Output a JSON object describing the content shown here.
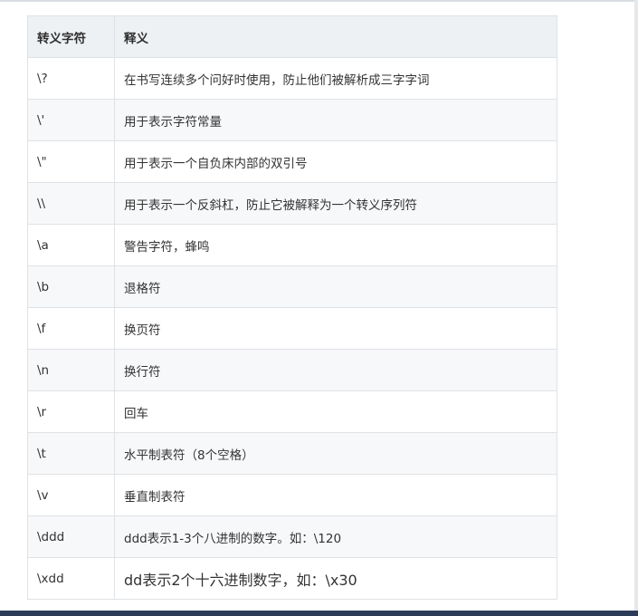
{
  "table": {
    "headers": [
      "转义字符",
      "释义"
    ],
    "rows": [
      {
        "code": "\\?",
        "desc": "在书写连续多个问好时使用，防止他们被解析成三字字词"
      },
      {
        "code": "\\'",
        "desc": "用于表示字符常量"
      },
      {
        "code": "\\\"",
        "desc": "用于表示一个自负床内部的双引号"
      },
      {
        "code": "\\\\",
        "desc": "用于表示一个反斜杠，防止它被解释为一个转义序列符"
      },
      {
        "code": "\\a",
        "desc": "警告字符，蜂鸣"
      },
      {
        "code": "\\b",
        "desc": "退格符"
      },
      {
        "code": "\\f",
        "desc": "换页符"
      },
      {
        "code": "\\n",
        "desc": "换行符"
      },
      {
        "code": "\\r",
        "desc": "回车"
      },
      {
        "code": "\\t",
        "desc": "水平制表符（8个空格）"
      },
      {
        "code": "\\v",
        "desc": "垂直制表符"
      },
      {
        "code": "\\ddd",
        "desc": "ddd表示1-3个八进制的数字。如：\\120"
      },
      {
        "code": "\\xdd",
        "desc": "dd表示2个十六进制数字，如：\\x30"
      }
    ]
  }
}
